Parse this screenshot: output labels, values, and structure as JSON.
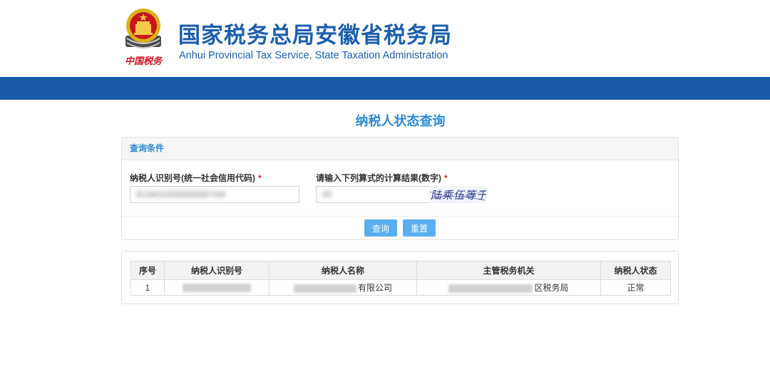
{
  "header": {
    "title_cn": "国家税务总局安徽省税务局",
    "title_en": "Anhui Provincial Tax Service, State Taxation Administration",
    "emblem_caption": "中国税务"
  },
  "page": {
    "title": "纳税人状态查询"
  },
  "query": {
    "section_title": "查询条件",
    "taxpayer_id_label": "纳税人识别号(统一社会信用代码)",
    "taxpayer_id_value": "9134010000000087XM",
    "captcha_label": "请输入下列算式的计算结果(数字)",
    "captcha_value": "00",
    "captcha_text": "陆乘伍等于",
    "required_mark": "*",
    "search_button": "查询",
    "reset_button": "重置"
  },
  "results": {
    "columns": [
      "序号",
      "纳税人识别号",
      "纳税人名称",
      "主管税务机关",
      "纳税人状态"
    ],
    "rows": [
      {
        "index": "1",
        "name_suffix": "有限公司",
        "authority_suffix": "区税务局",
        "status": "正常"
      }
    ]
  },
  "colors": {
    "brand_blue": "#1d5fad",
    "nav_blue": "#1b5ba8",
    "accent": "#2b8ad0",
    "button": "#5aaeee",
    "required": "#e02020"
  }
}
